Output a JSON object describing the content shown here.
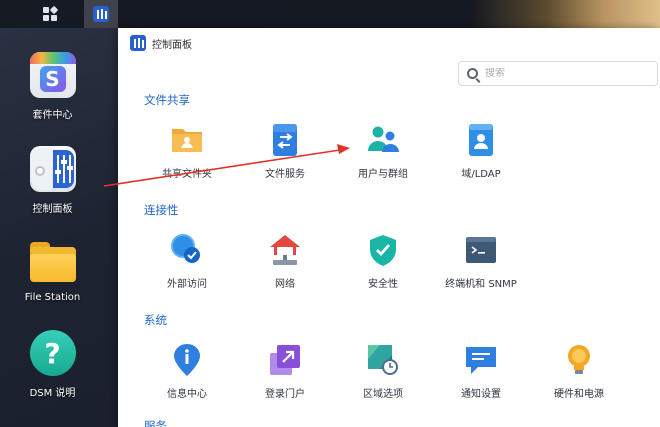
{
  "desktop": {
    "icons": [
      {
        "label": "套件中心"
      },
      {
        "label": "控制面板"
      },
      {
        "label": "File Station"
      },
      {
        "label": "DSM 说明"
      }
    ]
  },
  "window": {
    "title": "控制面板",
    "search": {
      "placeholder": "搜索",
      "value": ""
    },
    "sections": [
      {
        "title": "文件共享",
        "items": [
          {
            "label": "共享文件夹",
            "icon": "shared-folder-icon"
          },
          {
            "label": "文件服务",
            "icon": "file-services-icon"
          },
          {
            "label": "用户与群组",
            "icon": "user-group-icon"
          },
          {
            "label": "域/LDAP",
            "icon": "domain-ldap-icon"
          }
        ]
      },
      {
        "title": "连接性",
        "items": [
          {
            "label": "外部访问",
            "icon": "external-access-icon"
          },
          {
            "label": "网络",
            "icon": "network-icon"
          },
          {
            "label": "安全性",
            "icon": "security-icon"
          },
          {
            "label": "终端机和 SNMP",
            "icon": "terminal-icon"
          }
        ]
      },
      {
        "title": "系统",
        "items": [
          {
            "label": "信息中心",
            "icon": "info-center-icon"
          },
          {
            "label": "登录门户",
            "icon": "login-portal-icon"
          },
          {
            "label": "区域选项",
            "icon": "regional-options-icon"
          },
          {
            "label": "通知设置",
            "icon": "notification-icon"
          },
          {
            "label": "硬件和电源",
            "icon": "hardware-power-icon"
          }
        ]
      },
      {
        "title": "服务"
      }
    ]
  },
  "colors": {
    "accent": "#1e66c9",
    "arrow": "#e0332b"
  }
}
